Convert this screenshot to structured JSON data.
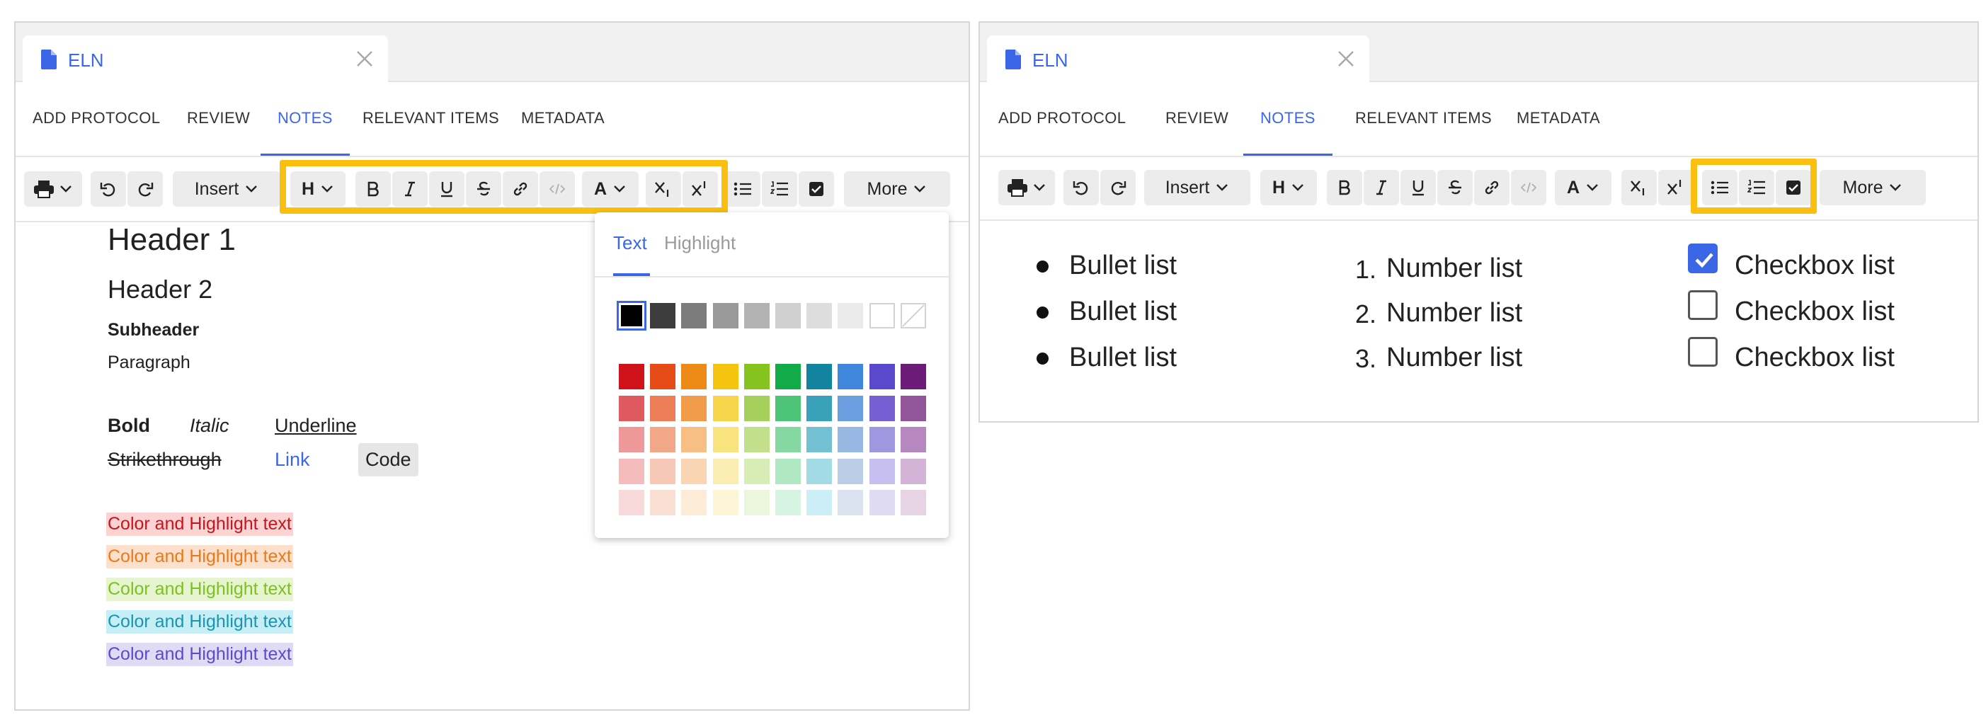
{
  "left": {
    "tab": {
      "title": "ELN"
    },
    "nav": [
      {
        "label": "ADD PROTOCOL",
        "active": false
      },
      {
        "label": "REVIEW",
        "active": false
      },
      {
        "label": "NOTES",
        "active": true
      },
      {
        "label": "RELEVANT ITEMS",
        "active": false
      },
      {
        "label": "METADATA",
        "active": false
      }
    ],
    "toolbar": {
      "insert_label": "Insert",
      "heading_glyph": "H",
      "color_glyph": "A",
      "more_label": "More"
    },
    "content": {
      "header1": "Header 1",
      "header2": "Header 2",
      "subheader": "Subheader",
      "paragraph": "Paragraph",
      "bold": "Bold",
      "italic": "Italic",
      "underline": "Underline",
      "strikethrough": "Strikethrough",
      "link": "Link",
      "code": "Code",
      "color_lines": [
        {
          "text": "Color and Highlight text",
          "color": "#c8141e",
          "bg": "#fbd3d3"
        },
        {
          "text": "Color and Highlight text",
          "color": "#ea7a19",
          "bg": "#fde0cc"
        },
        {
          "text": "Color and Highlight text",
          "color": "#7dc11f",
          "bg": "#e6f5cf"
        },
        {
          "text": "Color and Highlight text",
          "color": "#1a95b3",
          "bg": "#c5eef5"
        },
        {
          "text": "Color and Highlight text",
          "color": "#5b49cf",
          "bg": "#e0dbf5"
        }
      ]
    },
    "color_popup": {
      "tab_text": "Text",
      "tab_highlight": "Highlight",
      "gray_row": [
        "#000000",
        "#3d3d3d",
        "#7b7b7b",
        "#999999",
        "#b3b3b3",
        "#cfcfcf",
        "#dddddd",
        "#eaeaea",
        "#ffffff",
        "none"
      ],
      "grid": [
        [
          "#d0131b",
          "#e64c17",
          "#ee8a18",
          "#f4c40e",
          "#85c31e",
          "#11ab4a",
          "#13849f",
          "#3f86dd",
          "#5a48cd",
          "#6b1c77"
        ],
        [
          "#de5a5e",
          "#ec7f57",
          "#f09c4b",
          "#f7d54a",
          "#a6d05c",
          "#4ec479",
          "#3aa1bb",
          "#6b9ee0",
          "#7560d3",
          "#935599"
        ],
        [
          "#ee9899",
          "#f3a789",
          "#f8bf84",
          "#f9e37f",
          "#c2e08c",
          "#86d8a2",
          "#72c0d2",
          "#98b8e4",
          "#a097e1",
          "#b788bf"
        ],
        [
          "#f4bcbc",
          "#f7c8b5",
          "#fad5b4",
          "#fbedb2",
          "#d8ecb6",
          "#b1e8c4",
          "#a2dbe6",
          "#bccde8",
          "#c6bff0",
          "#d3b3d6"
        ],
        [
          "#f9dadb",
          "#fadfd4",
          "#fdecd8",
          "#fdf6d6",
          "#ebf6dc",
          "#d7f4e2",
          "#cbeef7",
          "#dae3ef",
          "#dedbf2",
          "#e6d3e4"
        ]
      ]
    }
  },
  "right": {
    "tab": {
      "title": "ELN"
    },
    "nav": [
      {
        "label": "ADD PROTOCOL",
        "active": false
      },
      {
        "label": "REVIEW",
        "active": false
      },
      {
        "label": "NOTES",
        "active": true
      },
      {
        "label": "RELEVANT ITEMS",
        "active": false
      },
      {
        "label": "METADATA",
        "active": false
      }
    ],
    "toolbar": {
      "insert_label": "Insert",
      "heading_glyph": "H",
      "color_glyph": "A",
      "more_label": "More"
    },
    "bullets": [
      "Bullet list",
      "Bullet list",
      "Bullet list"
    ],
    "numbers": [
      {
        "n": "1.",
        "text": "Number list"
      },
      {
        "n": "2.",
        "text": "Number list"
      },
      {
        "n": "3.",
        "text": "Number list"
      }
    ],
    "checkboxes": [
      {
        "text": "Checkbox list",
        "checked": true
      },
      {
        "text": "Checkbox list",
        "checked": false
      },
      {
        "text": "Checkbox list",
        "checked": false
      }
    ]
  },
  "colors": {
    "accent": "#3b67e6",
    "highlight_box": "#fbbf10",
    "toolbar_button": "#ececec"
  },
  "icons": [
    "file-icon",
    "close-icon",
    "print-icon",
    "undo-icon",
    "redo-icon",
    "heading-icon",
    "bold-icon",
    "italic-icon",
    "underline-icon",
    "strikethrough-icon",
    "link-icon",
    "code-icon",
    "text-color-icon",
    "subscript-icon",
    "superscript-icon",
    "bullet-list-icon",
    "numbered-list-icon",
    "checkbox-list-icon",
    "chevron-down-icon"
  ]
}
